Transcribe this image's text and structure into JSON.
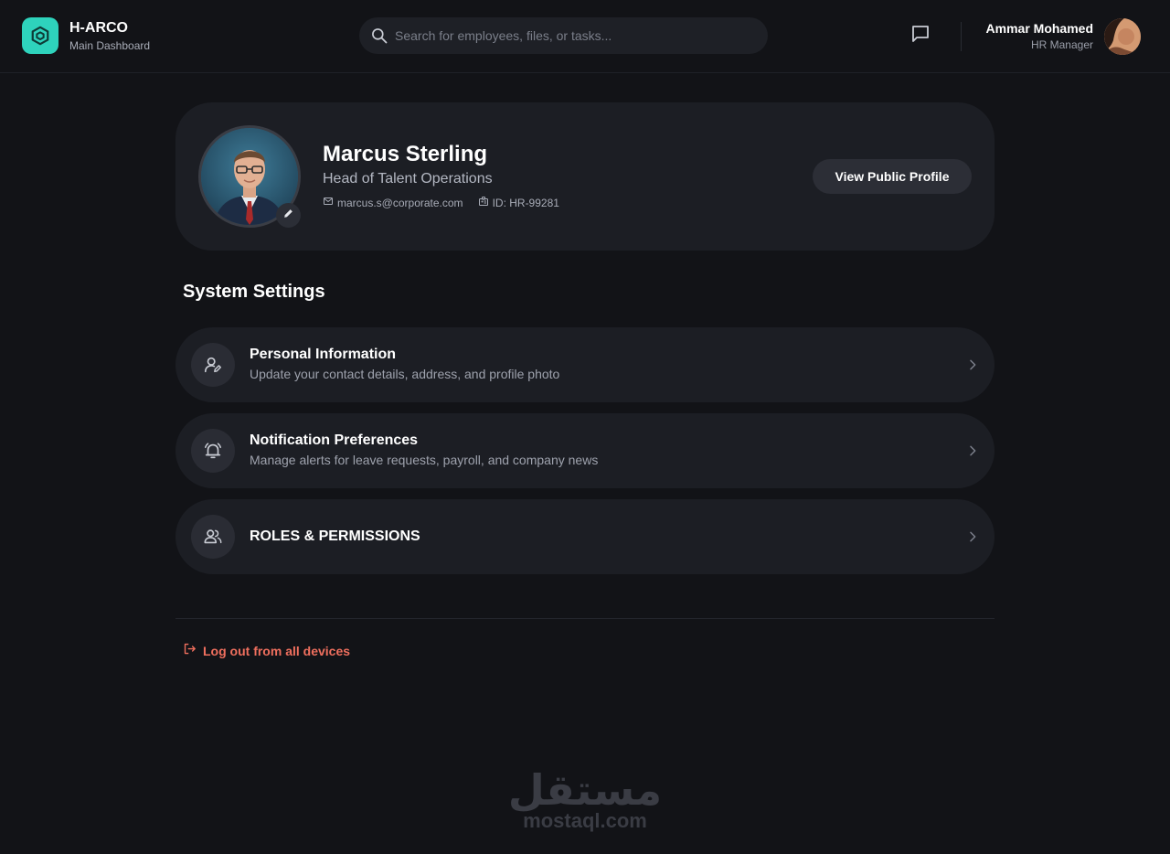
{
  "header": {
    "app_name": "H-ARCO",
    "app_subtitle": "Main Dashboard",
    "search_placeholder": "Search for employees, files, or tasks...",
    "user_name": "Ammar Mohamed",
    "user_role": "HR Manager"
  },
  "profile": {
    "name": "Marcus Sterling",
    "title": "Head of Talent Operations",
    "email": "marcus.s@corporate.com",
    "employee_id": "ID: HR-99281",
    "view_button": "View Public Profile"
  },
  "settings": {
    "section_title": "System Settings",
    "items": [
      {
        "title": "Personal Information",
        "description": "Update your contact details, address, and profile photo",
        "icon": "user-edit-icon"
      },
      {
        "title": "Notification Preferences",
        "description": "Manage alerts for leave requests, payroll, and company news",
        "icon": "bell-ring-icon"
      },
      {
        "title": "ROLES & PERMISSIONS",
        "description": "",
        "icon": "users-icon"
      }
    ]
  },
  "logout_label": "Log out from all devices",
  "watermark": {
    "arabic": "مستقل",
    "latin": "mostaql.com"
  },
  "colors": {
    "accent": "#2ed3bc",
    "danger": "#ef6f5e",
    "card": "#1c1e24",
    "background": "#121317"
  }
}
